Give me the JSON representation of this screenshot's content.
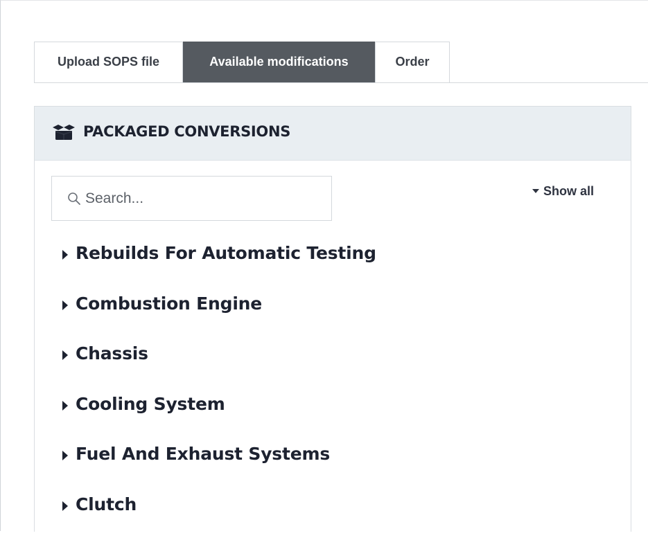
{
  "tabs": [
    {
      "label": "Upload SOPS file",
      "active": false
    },
    {
      "label": "Available modifications",
      "active": true
    },
    {
      "label": "Order",
      "active": false
    }
  ],
  "panel": {
    "title": "PACKAGED CONVERSIONS",
    "icon": "box-open-icon"
  },
  "search": {
    "placeholder": "Search...",
    "value": ""
  },
  "show_all": {
    "label": "Show all",
    "icon": "caret-down-icon"
  },
  "categories": [
    {
      "label": "Rebuilds For Automatic Testing"
    },
    {
      "label": "Combustion Engine"
    },
    {
      "label": "Chassis"
    },
    {
      "label": "Cooling System"
    },
    {
      "label": "Fuel And Exhaust Systems"
    },
    {
      "label": "Clutch"
    }
  ],
  "colors": {
    "active_tab_bg": "#555a60",
    "panel_header_bg": "#e9eef2",
    "text_dark": "#1d2230"
  }
}
